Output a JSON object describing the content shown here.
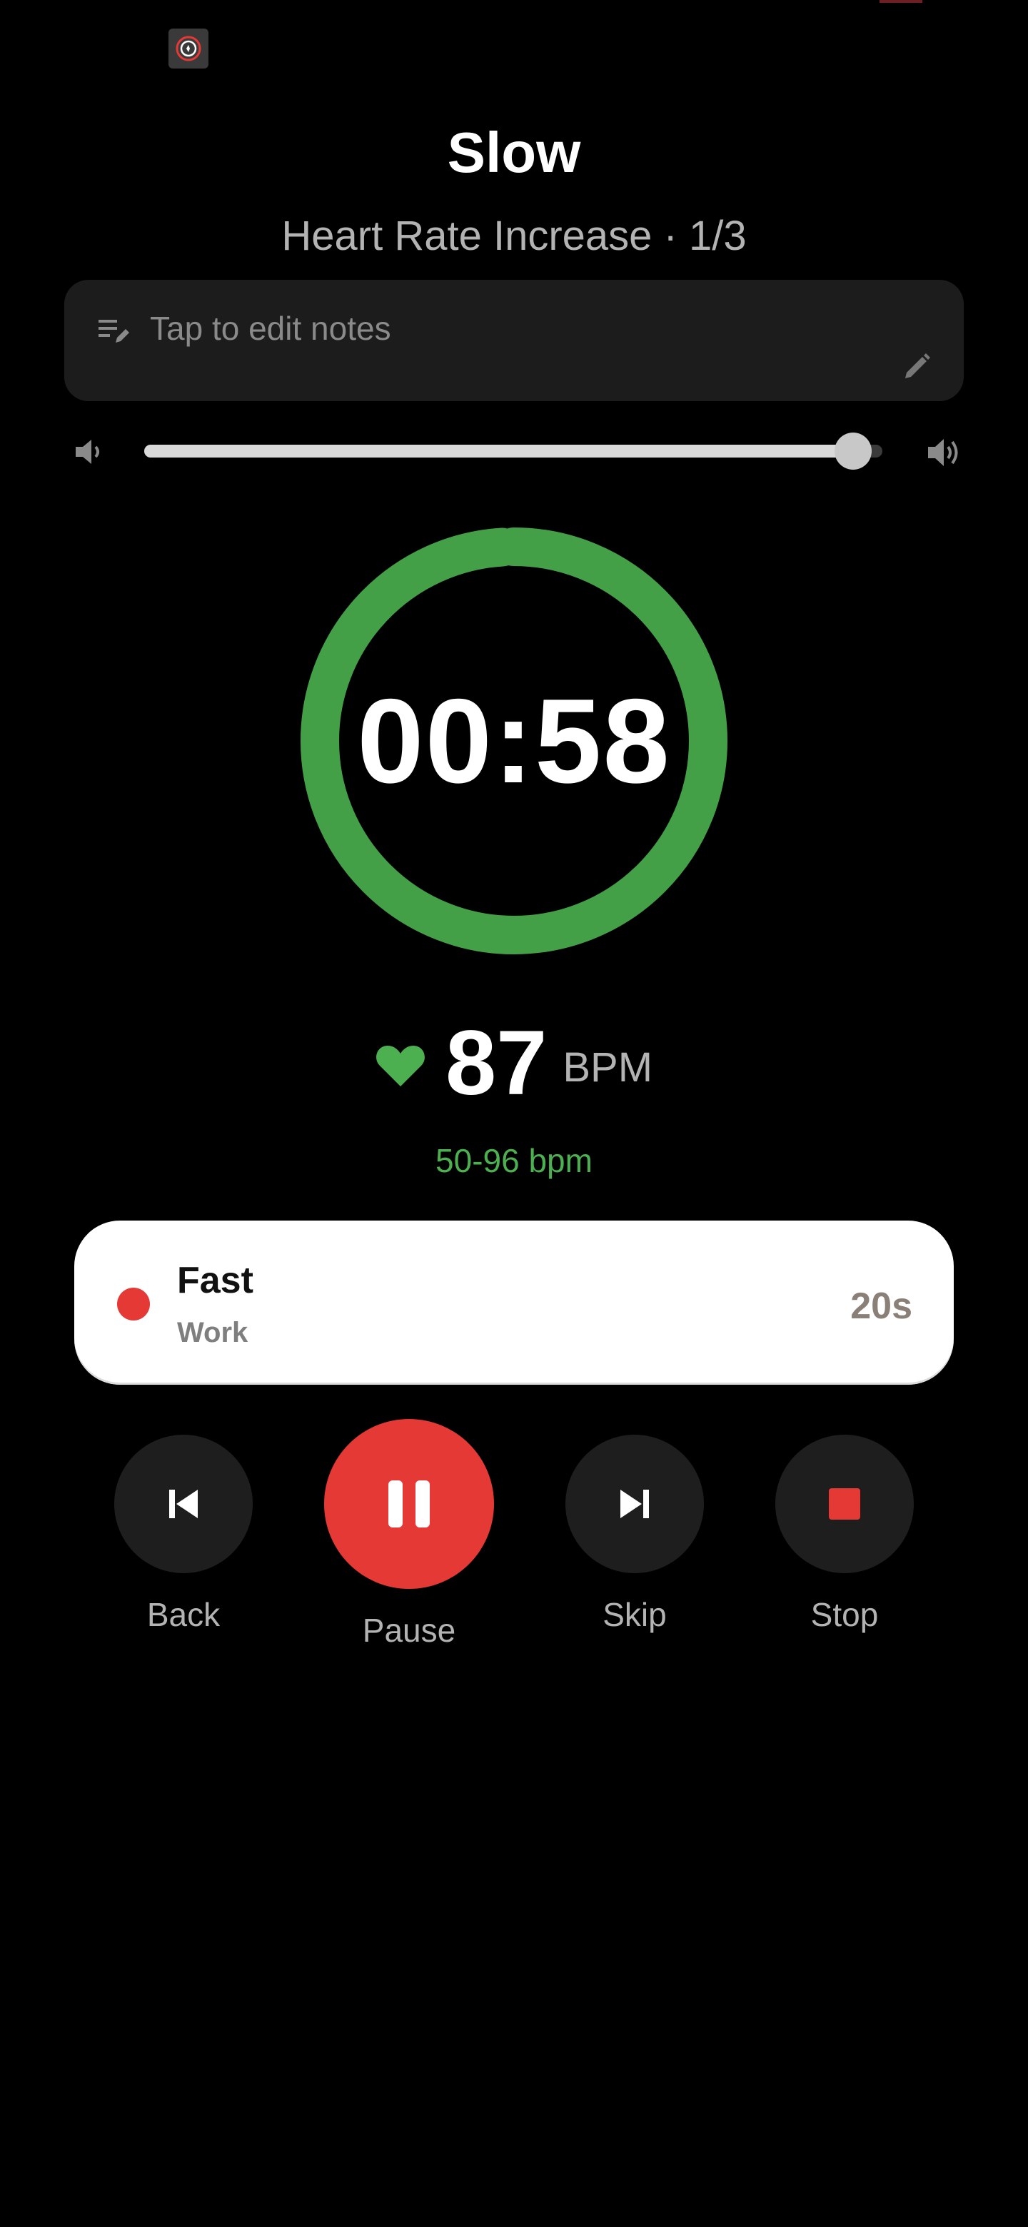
{
  "workout": {
    "title": "Slow",
    "subtitle": "Heart Rate Increase · 1/3"
  },
  "notes": {
    "placeholder": "Tap to edit notes",
    "icon": "notes-icon",
    "edit_icon": "pencil-icon"
  },
  "volume": {
    "level": 0.96,
    "low_icon": "volume-low-icon",
    "high_icon": "volume-high-icon"
  },
  "timer": {
    "display": "00:58",
    "progress": 0.99,
    "ring_color": "#43a047"
  },
  "heart_rate": {
    "value": "87",
    "unit": "BPM",
    "zone": "50-96 bpm",
    "color": "#4caf50"
  },
  "next_interval": {
    "name": "Fast",
    "type": "Work",
    "duration": "20s",
    "dot_color": "#e53935"
  },
  "controls": {
    "back_label": "Back",
    "pause_label": "Pause",
    "skip_label": "Skip",
    "stop_label": "Stop",
    "pause_color": "#e53935",
    "stop_color": "#e53935"
  }
}
